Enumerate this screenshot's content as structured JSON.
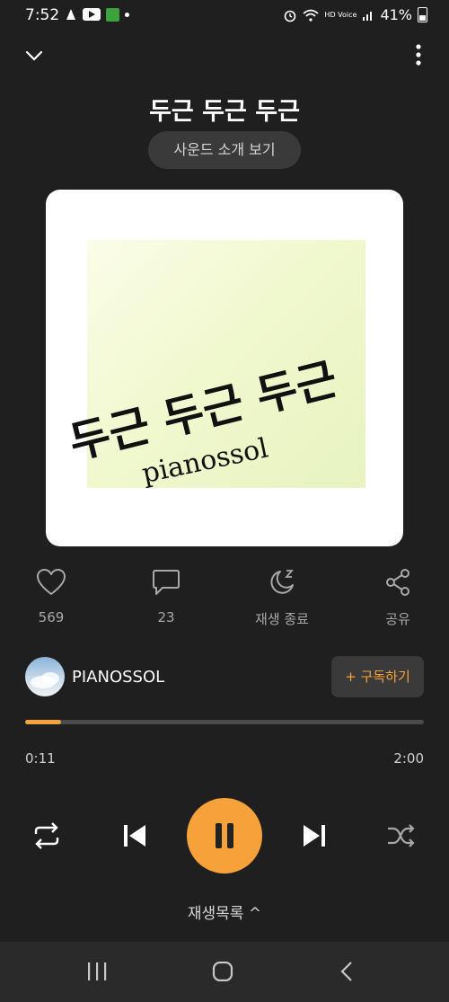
{
  "status_bar": {
    "time": "7:52",
    "battery": "41%",
    "network_label": "HD Voice"
  },
  "header": {
    "title": "두근 두근 두근",
    "intro_button": "사운드 소개 보기"
  },
  "cover": {
    "title_text": "두근 두근 두근",
    "artist_text": "pianossol"
  },
  "actions": {
    "like_count": "569",
    "comment_count": "23",
    "sleep_label": "재생 종료",
    "share_label": "공유"
  },
  "artist": {
    "name": "PIANOSSOL",
    "subscribe_label": "+ 구독하기"
  },
  "playback": {
    "current_time": "0:11",
    "total_time": "2:00",
    "progress_fraction": 0.09
  },
  "playlist_label": "재생목록 ^",
  "colors": {
    "accent": "#f7a13a",
    "background": "#1f1f1f"
  },
  "icons": [
    "heart-icon",
    "comment-icon",
    "sleep-timer-icon",
    "share-icon",
    "repeat-icon",
    "previous-icon",
    "pause-icon",
    "next-icon",
    "shuffle-icon"
  ]
}
